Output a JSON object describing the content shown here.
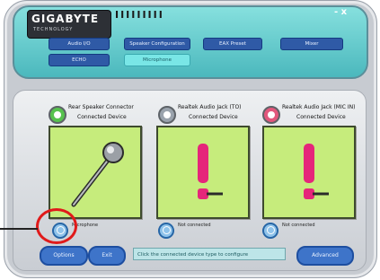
{
  "header": {
    "logo_text": "GIGABYTE",
    "logo_sub": "TECHNOLOGY",
    "title": "IIIIIIIII",
    "controls": "- x",
    "tabs_row1": [
      "Audio I/O",
      "Speaker Configuration",
      "EAX Preset",
      "Mixer"
    ],
    "tabs_row2": [
      "ECHO",
      "Microphone"
    ]
  },
  "jacks": [
    {
      "title": "Rear Speaker Connector",
      "subtitle": "Connected Device",
      "ring_color": "#57c24f"
    },
    {
      "title": "Realtek Audio Jack (TO)",
      "subtitle": "Connected Device",
      "ring_color": "#9aa3ad"
    },
    {
      "title": "Realtek Audio Jack (MIC IN)",
      "subtitle": "Connected Device",
      "ring_color": "#e2577c"
    }
  ],
  "small_labels": [
    "Microphone",
    "Not connected",
    "Not connected"
  ],
  "footer": {
    "left_btn": "Options",
    "mid_btn": "Exit",
    "status": "Click the connected device type to configure",
    "right_btn": "Advanced"
  }
}
